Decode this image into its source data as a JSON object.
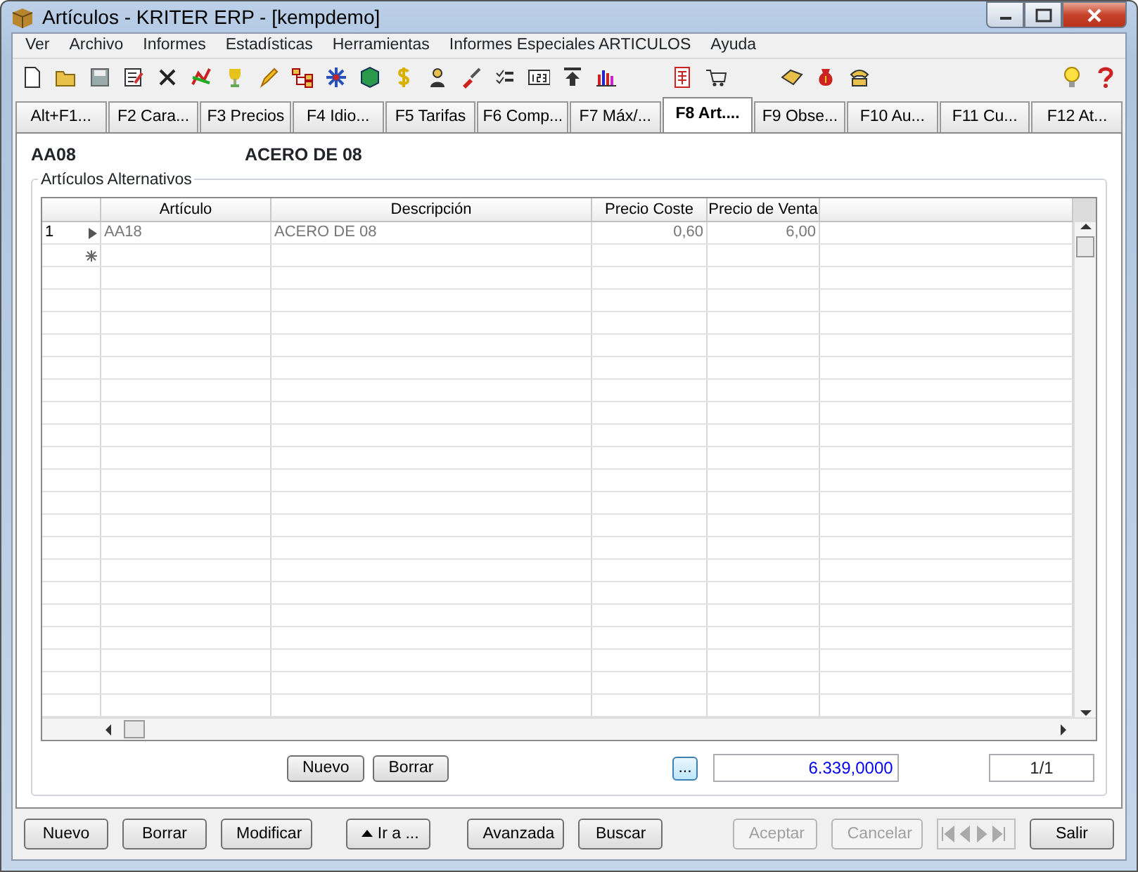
{
  "window": {
    "title": "Artículos - KRITER ERP - [kempdemo]"
  },
  "menu": [
    "Ver",
    "Archivo",
    "Informes",
    "Estadísticas",
    "Herramientas",
    "Informes Especiales ARTICULOS",
    "Ayuda"
  ],
  "tabs": [
    {
      "label": "Alt+F1...",
      "selected": false
    },
    {
      "label": "F2 Cara...",
      "selected": false
    },
    {
      "label": "F3 Precios",
      "selected": false
    },
    {
      "label": "F4 Idio...",
      "selected": false
    },
    {
      "label": "F5 Tarifas",
      "selected": false
    },
    {
      "label": "F6 Comp...",
      "selected": false
    },
    {
      "label": "F7 Máx/...",
      "selected": false
    },
    {
      "label": "F8 Art....",
      "selected": true
    },
    {
      "label": "F9 Obse...",
      "selected": false
    },
    {
      "label": "F10 Au...",
      "selected": false
    },
    {
      "label": "F11 Cu...",
      "selected": false
    },
    {
      "label": "F12 At...",
      "selected": false
    }
  ],
  "header": {
    "code": "AA08",
    "name": "ACERO DE 08"
  },
  "group": {
    "title": "Artículos Alternativos",
    "table": {
      "columns": [
        "Artículo",
        "Descripción",
        "Precio Coste",
        "Precio de Venta"
      ],
      "rows": [
        {
          "kind": "data",
          "number": "1",
          "current": true,
          "cells": [
            "AA18",
            "ACERO DE 08",
            "0,60",
            "6,00"
          ]
        },
        {
          "kind": "new"
        }
      ]
    },
    "buttons": [
      {
        "label": "Nuevo",
        "disabled": false
      },
      {
        "label": "Borrar",
        "disabled": false
      }
    ],
    "more_button": "...",
    "total": "6.339,0000",
    "pager": "1/1"
  },
  "footer_buttons": [
    {
      "label": "Nuevo",
      "kind": "button",
      "disabled": false
    },
    {
      "label": "Borrar",
      "kind": "button",
      "disabled": false
    },
    {
      "label": "Modificar",
      "kind": "button",
      "disabled": false
    },
    {
      "label": "Ir a ...",
      "kind": "goto",
      "disabled": false
    },
    {
      "label": "Avanzada",
      "kind": "button",
      "disabled": false
    },
    {
      "label": "Buscar",
      "kind": "button",
      "disabled": false
    },
    {
      "label": "Aceptar",
      "kind": "button",
      "disabled": true
    },
    {
      "label": "Cancelar",
      "kind": "button",
      "disabled": true
    },
    {
      "kind": "nav",
      "disabled": true
    },
    {
      "label": "Salir",
      "kind": "button",
      "disabled": false
    }
  ]
}
